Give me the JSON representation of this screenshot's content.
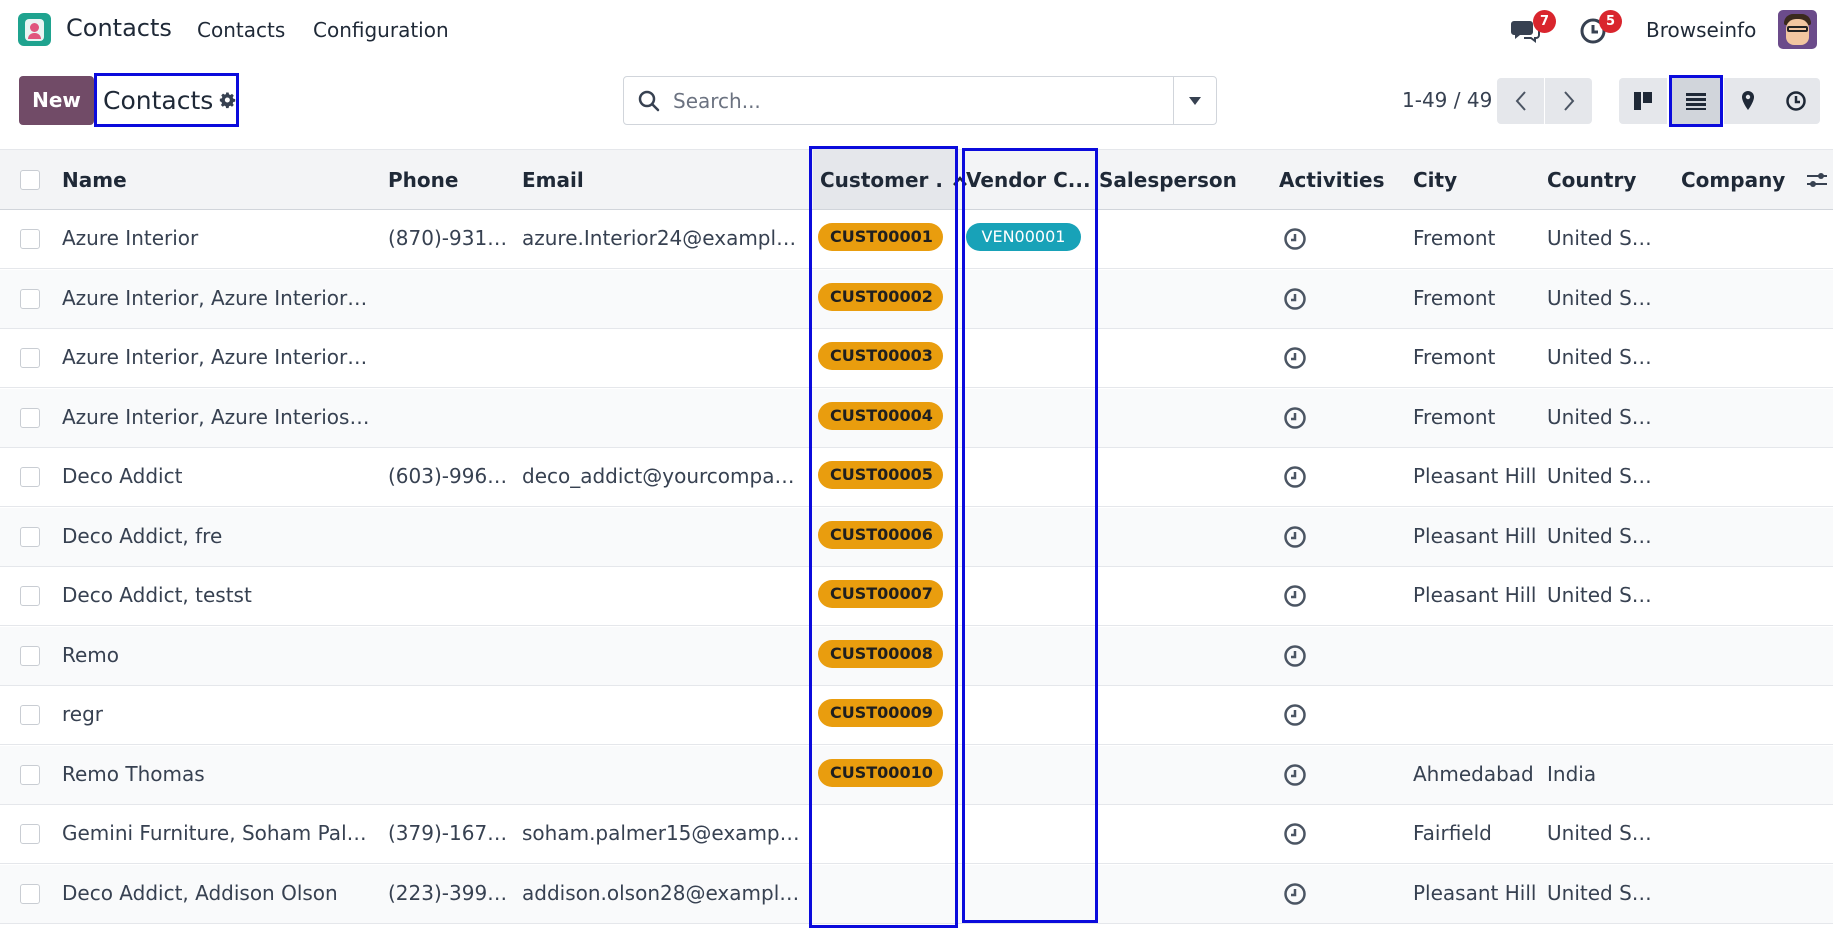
{
  "app": {
    "name": "Contacts"
  },
  "nav": {
    "menu": [
      "Contacts",
      "Configuration"
    ],
    "messages_badge": "7",
    "activities_badge": "5",
    "user": "Browseinfo"
  },
  "control": {
    "new_label": "New",
    "breadcrumb": "Contacts",
    "search_placeholder": "Search...",
    "pager": "1-49 / 49"
  },
  "table": {
    "columns": {
      "name": "Name",
      "phone": "Phone",
      "email": "Email",
      "customer": "Customer .",
      "vendor": "Vendor C...",
      "salesperson": "Salesperson",
      "activities": "Activities",
      "city": "City",
      "country": "Country",
      "company": "Company"
    },
    "rows": [
      {
        "name": "Azure Interior",
        "phone": "(870)-931-...",
        "email": "azure.Interior24@example....",
        "customer": "CUST00001",
        "vendor": "VEN00001",
        "city": "Fremont",
        "country": "United St..."
      },
      {
        "name": "Azure Interior, Azure Interior, ...",
        "phone": "",
        "email": "",
        "customer": "CUST00002",
        "vendor": "",
        "city": "Fremont",
        "country": "United St..."
      },
      {
        "name": "Azure Interior, Azure Interior, ...",
        "phone": "",
        "email": "",
        "customer": "CUST00003",
        "vendor": "",
        "city": "Fremont",
        "country": "United St..."
      },
      {
        "name": "Azure Interior, Azure Interios, ...",
        "phone": "",
        "email": "",
        "customer": "CUST00004",
        "vendor": "",
        "city": "Fremont",
        "country": "United St..."
      },
      {
        "name": "Deco Addict",
        "phone": "(603)-996-...",
        "email": "deco_addict@yourcompan...",
        "customer": "CUST00005",
        "vendor": "",
        "city": "Pleasant Hill",
        "country": "United St..."
      },
      {
        "name": "Deco Addict, fre",
        "phone": "",
        "email": "",
        "customer": "CUST00006",
        "vendor": "",
        "city": "Pleasant Hill",
        "country": "United St..."
      },
      {
        "name": "Deco Addict, testst",
        "phone": "",
        "email": "",
        "customer": "CUST00007",
        "vendor": "",
        "city": "Pleasant Hill",
        "country": "United St..."
      },
      {
        "name": "Remo",
        "phone": "",
        "email": "",
        "customer": "CUST00008",
        "vendor": "",
        "city": "",
        "country": ""
      },
      {
        "name": "regr",
        "phone": "",
        "email": "",
        "customer": "CUST00009",
        "vendor": "",
        "city": "",
        "country": ""
      },
      {
        "name": "Remo Thomas",
        "phone": "",
        "email": "",
        "customer": "CUST00010",
        "vendor": "",
        "city": "Ahmedabad",
        "country": "India"
      },
      {
        "name": "Gemini Furniture, Soham Palmer",
        "phone": "(379)-167-...",
        "email": "soham.palmer15@example...",
        "customer": "",
        "vendor": "",
        "city": "Fairfield",
        "country": "United St..."
      },
      {
        "name": "Deco Addict, Addison Olson",
        "phone": "(223)-399-...",
        "email": "addison.olson28@example....",
        "customer": "",
        "vendor": "",
        "city": "Pleasant Hill",
        "country": "United St..."
      }
    ]
  },
  "colors": {
    "primary": "#714b67",
    "customer_tag": "#e99d0e",
    "vendor_tag": "#18a2b8",
    "badge": "#d9252d",
    "highlight": "#0b0bdc"
  }
}
